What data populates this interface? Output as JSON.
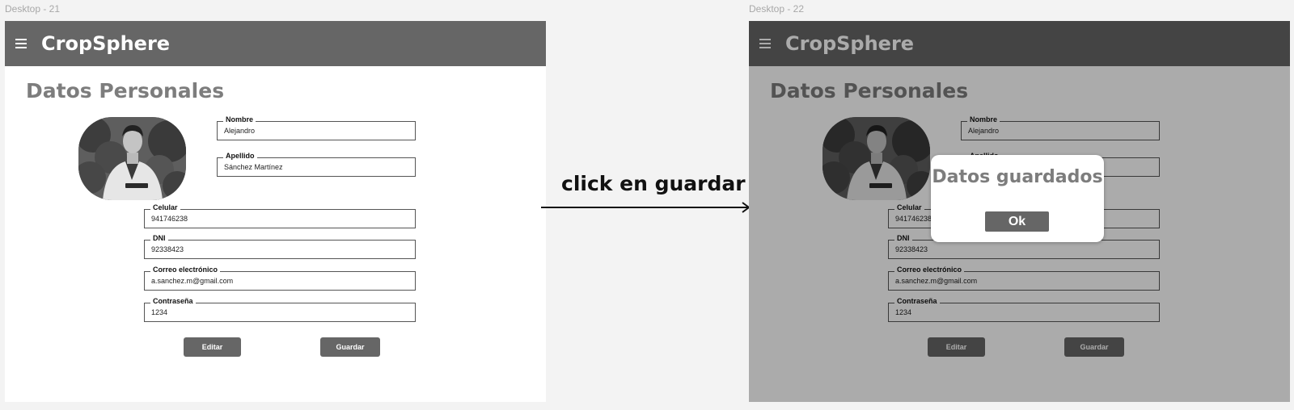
{
  "frames": {
    "before": {
      "label": "Desktop - 21"
    },
    "after": {
      "label": "Desktop - 22"
    }
  },
  "app": {
    "title": "CropSphere",
    "menu_icon": "hamburger-menu-icon"
  },
  "page": {
    "title": "Datos Personales"
  },
  "form": {
    "nombre": {
      "label": "Nombre",
      "value": "Alejandro"
    },
    "apellido": {
      "label": "Apellido",
      "value": "Sánchez Martínez"
    },
    "celular": {
      "label": "Celular",
      "value": "941746238"
    },
    "dni": {
      "label": "DNI",
      "value": "92338423"
    },
    "correo": {
      "label": "Correo electrónico",
      "value": "a.sanchez.m@gmail.com"
    },
    "contrasena": {
      "label": "Contraseña",
      "value": "1234"
    }
  },
  "buttons": {
    "editar": "Editar",
    "guardar": "Guardar"
  },
  "dialog": {
    "title": "Datos guardados",
    "ok": "Ok"
  },
  "transition": {
    "label": "click en guardar"
  },
  "colors": {
    "appbar": "#666666",
    "button": "#666666",
    "title_gray": "#7d7d7d",
    "overlay": "rgba(0,0,0,0.33)"
  }
}
